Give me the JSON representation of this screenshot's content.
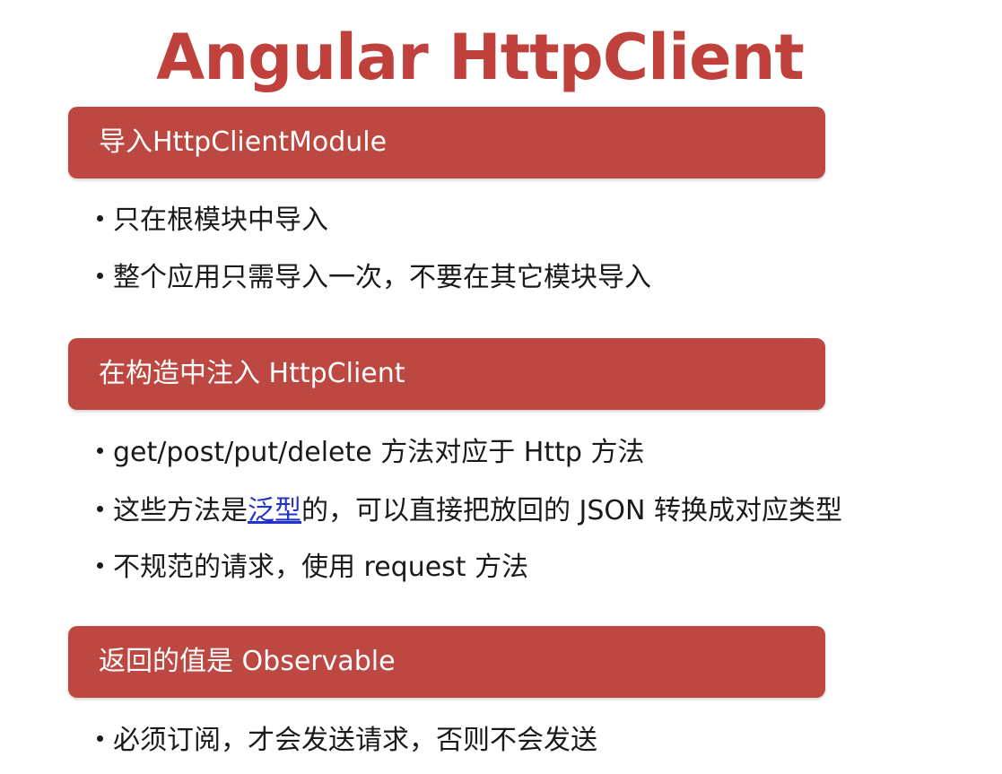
{
  "title": "Angular HttpClient",
  "sections": [
    {
      "header": "导入HttpClientModule",
      "bullets": [
        "只在根模块中导入",
        "整个应用只需导入一次，不要在其它模块导入"
      ]
    },
    {
      "header": "在构造中注入 HttpClient",
      "bullets": [
        "get/post/put/delete 方法对应于 Http 方法",
        {
          "before": "这些方法是",
          "link": "泛型",
          "after": "的，可以直接把放回的 JSON 转换成对应类型"
        },
        "不规范的请求，使用 request 方法"
      ]
    },
    {
      "header": "返回的值是 Observable",
      "bullets": [
        "必须订阅，才会发送请求，否则不会发送"
      ]
    }
  ],
  "colors": {
    "title": "#c0403b",
    "header_bar": "#bd4741",
    "link": "#2233cc"
  }
}
